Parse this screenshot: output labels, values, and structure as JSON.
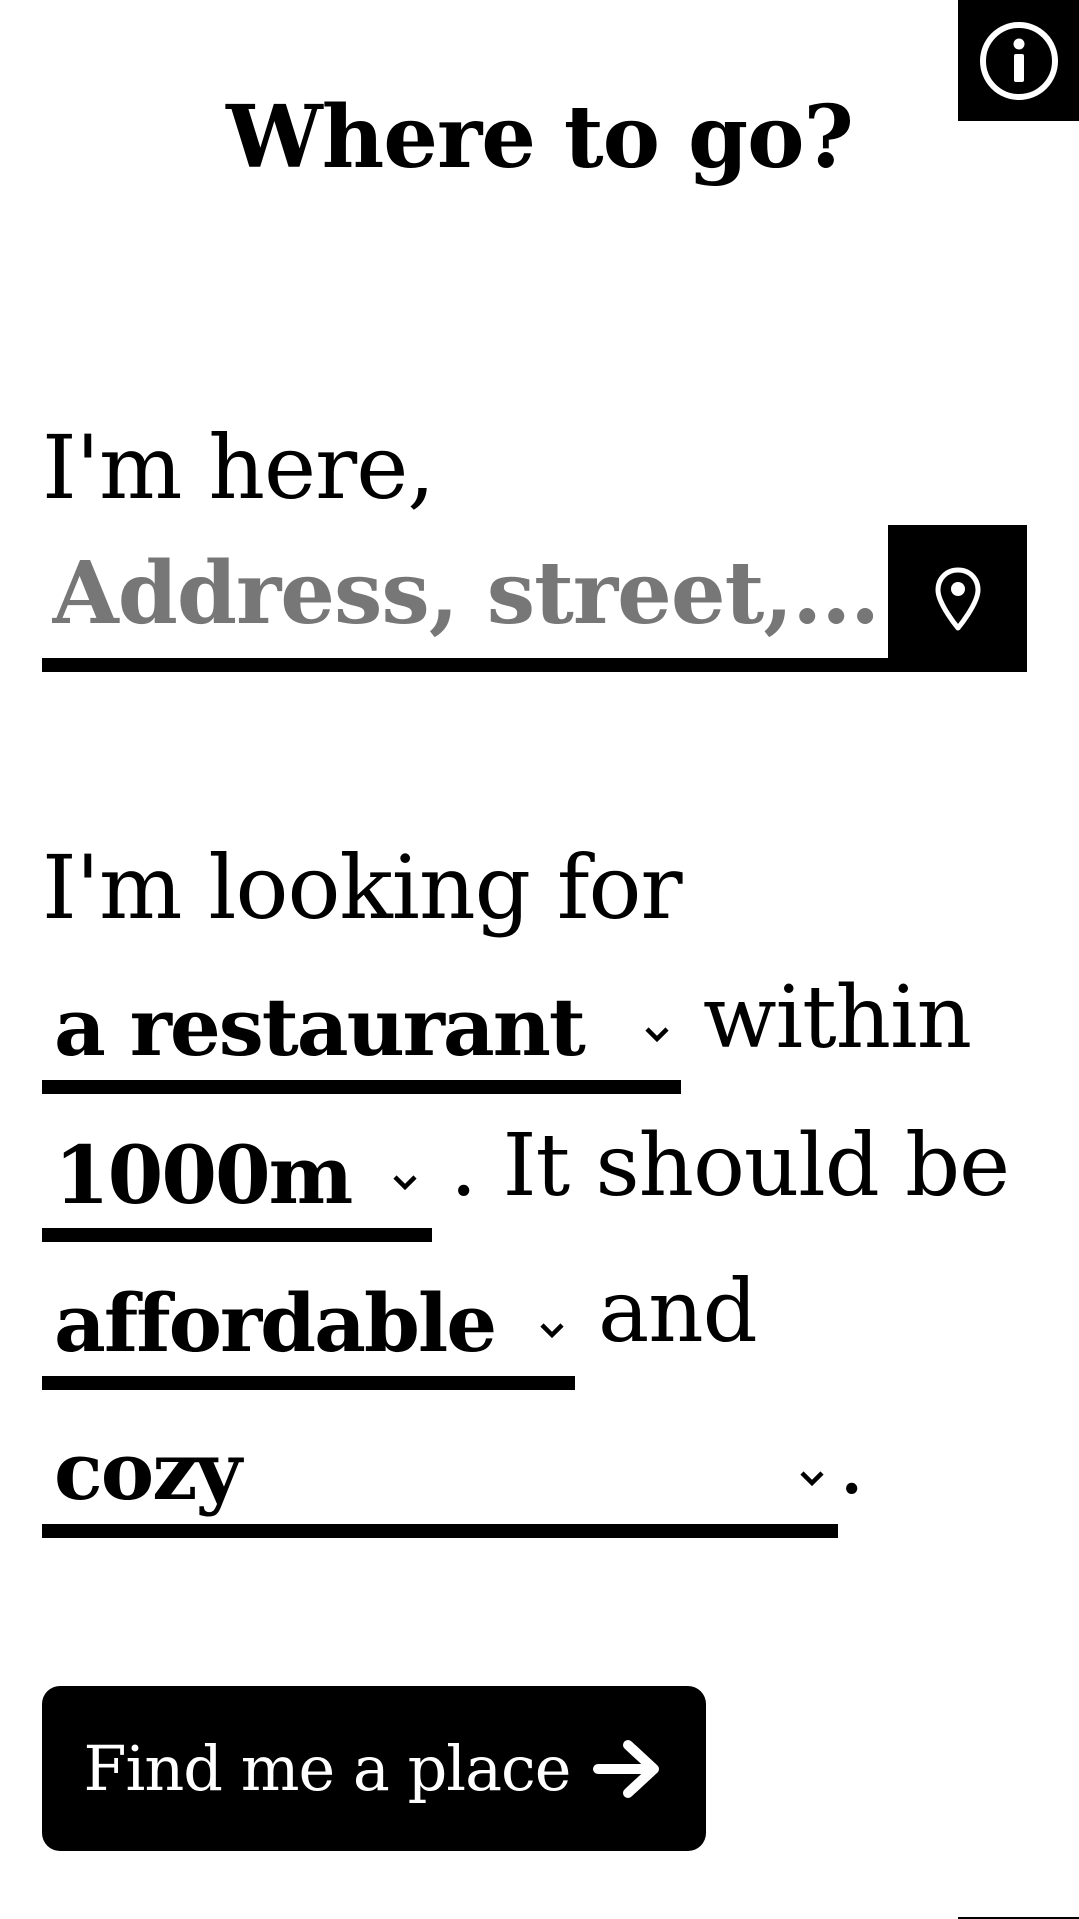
{
  "header": {
    "title": "Where to go?",
    "info_icon": "info-circle-icon"
  },
  "location": {
    "intro": "I'm here,",
    "address_placeholder": "Address, street,...",
    "address_value": "",
    "locate_icon": "map-pin-icon"
  },
  "search": {
    "intro": "I'm looking for",
    "place_type": "a restaurant",
    "within_text": "within",
    "distance": "1000m",
    "should_be_text": ". It should be",
    "price": "affordable",
    "and_text": "and",
    "ambience": "cozy",
    "end_period": ".",
    "chevron_icon": "chevron-down-icon"
  },
  "cta": {
    "label": "Find me a place",
    "icon": "arrow-right-icon"
  },
  "colors": {
    "background": "#ffffff",
    "foreground": "#000000",
    "placeholder": "#777777"
  }
}
